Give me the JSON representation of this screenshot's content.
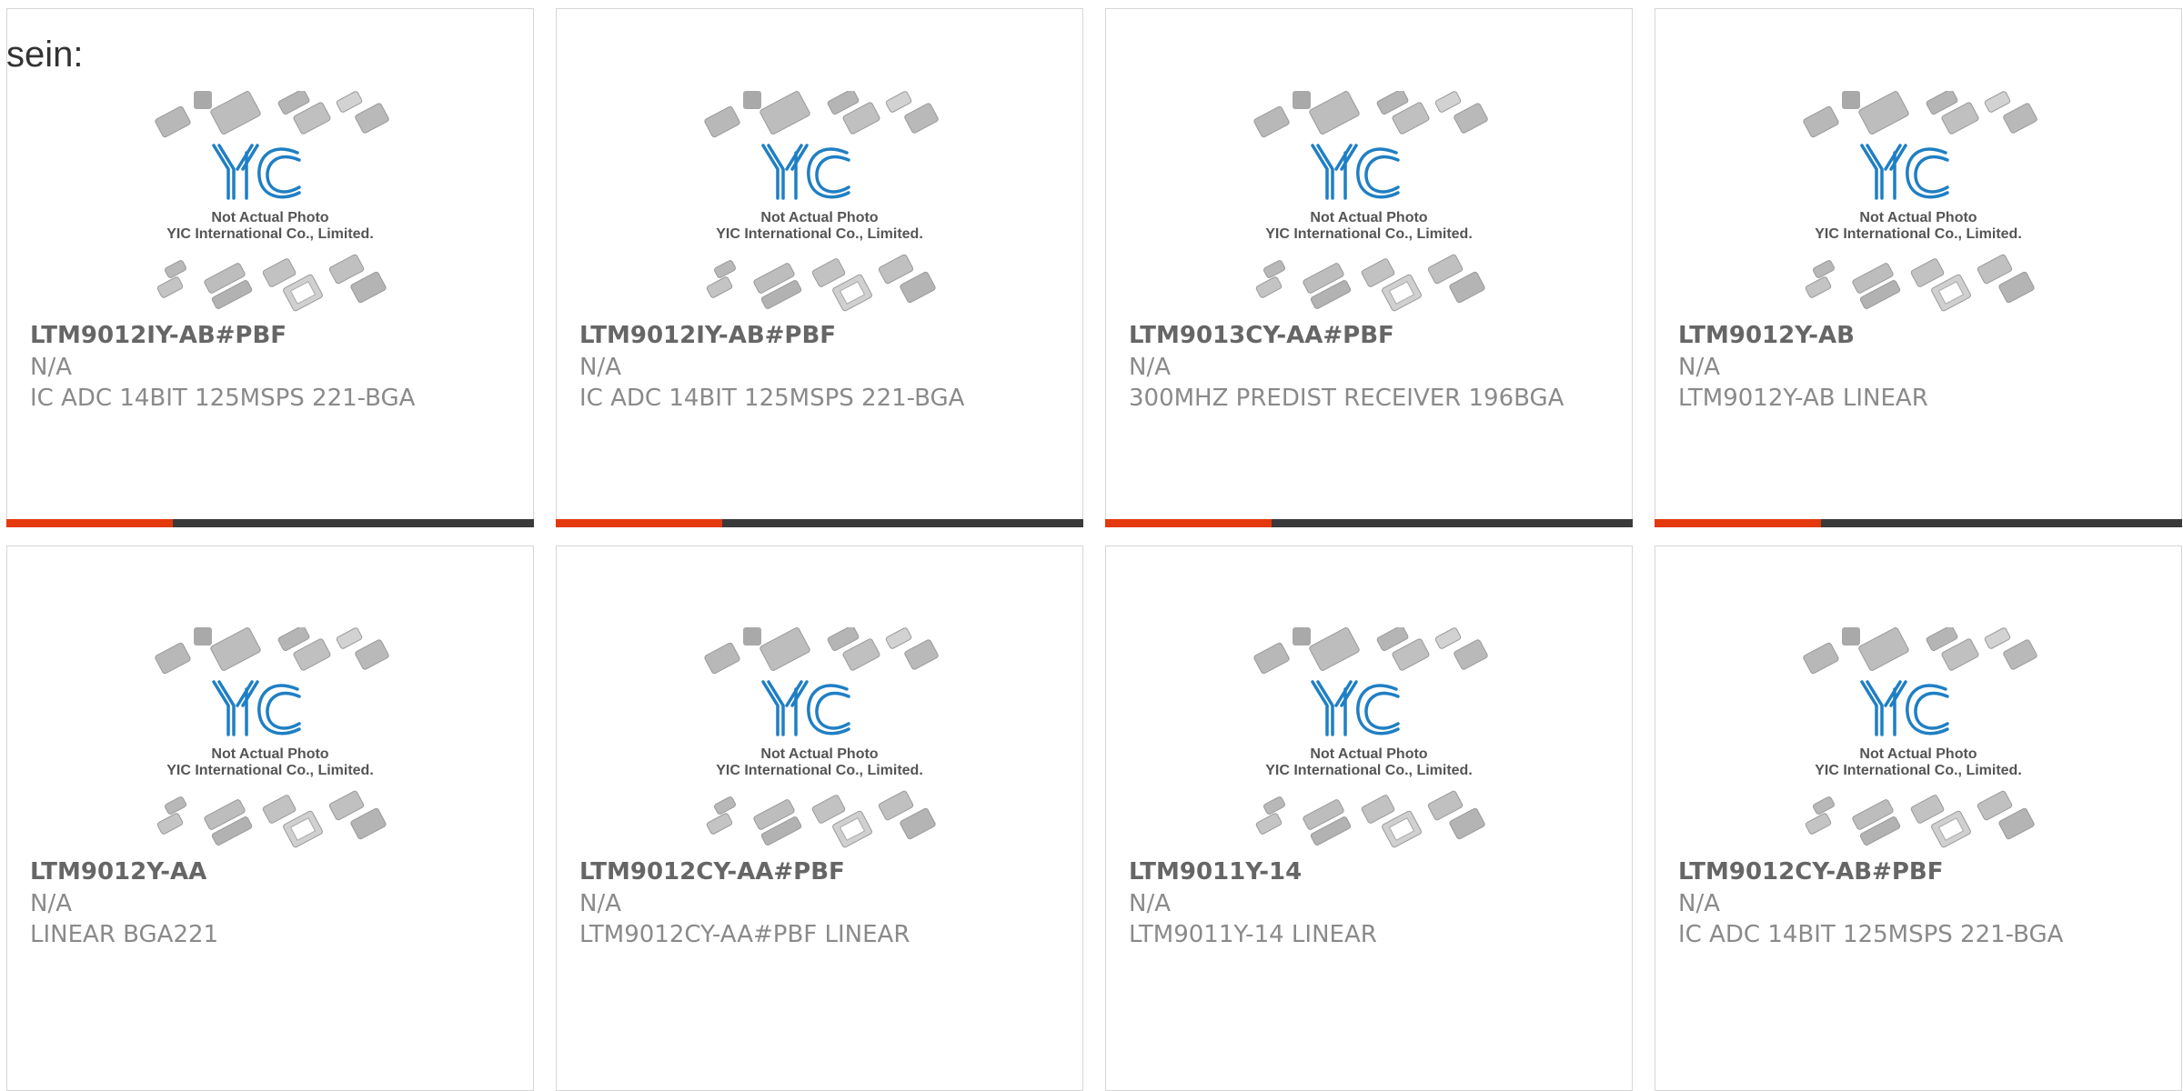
{
  "header": {
    "prefix_text": "sein:"
  },
  "placeholder": {
    "line1": "Not Actual Photo",
    "line2": "YIC International Co., Limited.",
    "logo_text": "YIC"
  },
  "colors": {
    "accent": "#e4380d",
    "bar_dark": "#3a3a3a",
    "logo_blue": "#1f7fc4",
    "text_bold": "#666666",
    "text_light": "#8a8a8a"
  },
  "products": [
    {
      "part_no": "LTM9012IY-AB#PBF",
      "manufacturer": "N/A",
      "description": "IC ADC 14BIT 125MSPS 221-BGA"
    },
    {
      "part_no": "LTM9012IY-AB#PBF",
      "manufacturer": "N/A",
      "description": "IC ADC 14BIT 125MSPS 221-BGA"
    },
    {
      "part_no": "LTM9013CY-AA#PBF",
      "manufacturer": "N/A",
      "description": "300MHZ PREDIST RECEIVER 196BGA"
    },
    {
      "part_no": "LTM9012Y-AB",
      "manufacturer": "N/A",
      "description": "LTM9012Y-AB LINEAR"
    },
    {
      "part_no": "LTM9012Y-AA",
      "manufacturer": "N/A",
      "description": "LINEAR BGA221"
    },
    {
      "part_no": "LTM9012CY-AA#PBF",
      "manufacturer": "N/A",
      "description": "LTM9012CY-AA#PBF LINEAR"
    },
    {
      "part_no": "LTM9011Y-14",
      "manufacturer": "N/A",
      "description": "LTM9011Y-14 LINEAR"
    },
    {
      "part_no": "LTM9012CY-AB#PBF",
      "manufacturer": "N/A",
      "description": "IC ADC 14BIT 125MSPS 221-BGA"
    }
  ]
}
